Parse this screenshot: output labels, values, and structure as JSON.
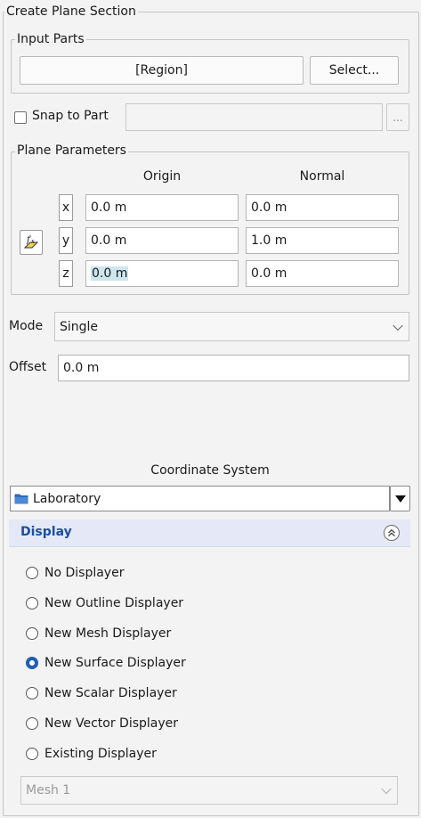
{
  "title": "Create Plane Section",
  "input_parts": {
    "legend": "Input Parts",
    "region_button": "[Region]",
    "select_button": "Select..."
  },
  "snap": {
    "label": "Snap to Part",
    "checked": false,
    "value": "",
    "browse_button": "..."
  },
  "plane": {
    "legend": "Plane Parameters",
    "origin_header": "Origin",
    "normal_header": "Normal",
    "axes": [
      "x",
      "y",
      "z"
    ],
    "origin": [
      "0.0 m",
      "0.0 m",
      "0.0 m"
    ],
    "normal": [
      "0.0 m",
      "1.0 m",
      "0.0 m"
    ]
  },
  "mode": {
    "label": "Mode",
    "value": "Single"
  },
  "offset": {
    "label": "Offset",
    "value": "0.0 m"
  },
  "coordinate_system": {
    "label": "Coordinate System",
    "value": "Laboratory"
  },
  "display": {
    "title": "Display",
    "options": [
      "No Displayer",
      "New Outline Displayer",
      "New Mesh Displayer",
      "New Surface Displayer",
      "New Scalar Displayer",
      "New Vector Displayer",
      "Existing Displayer"
    ],
    "selected": "New Surface Displayer",
    "existing_value": "Mesh 1"
  },
  "colors": {
    "accent": "#1e5fb4",
    "display_header": "#e4e8f7",
    "selection": "#cde6ef"
  }
}
